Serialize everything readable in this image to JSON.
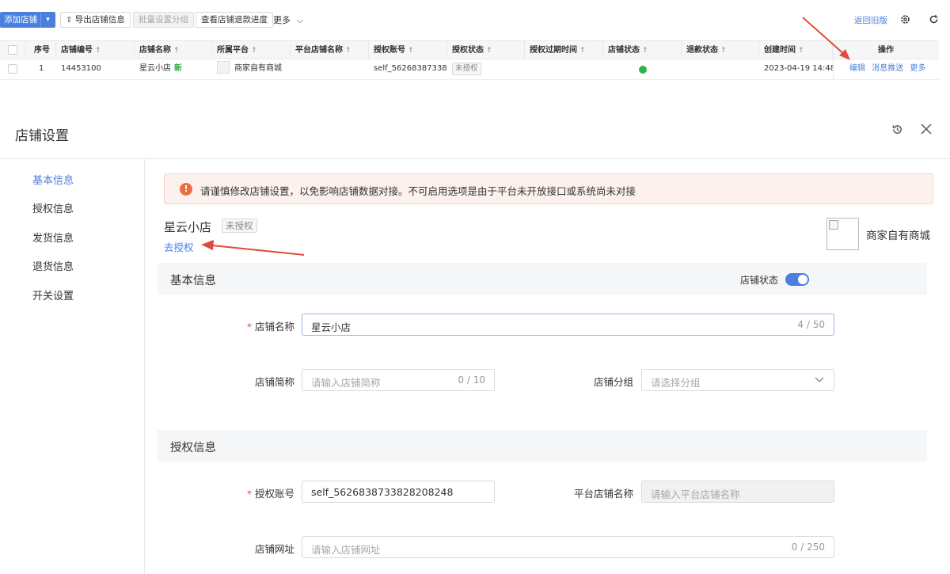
{
  "toolbar": {
    "add_store": "添加店铺",
    "export": "导出店铺信息",
    "batch_group": "批量设置分组",
    "refund_progress": "查看店铺退款进度",
    "more": "更多",
    "back_old": "返回旧版"
  },
  "table": {
    "headers": [
      "序号",
      "店铺编号",
      "店铺名称",
      "所属平台",
      "平台店铺名称",
      "授权账号",
      "授权状态",
      "授权过期时间",
      "店铺状态",
      "退款状态",
      "创建时间",
      "操作"
    ],
    "row": {
      "index": "1",
      "store_id": "14453100",
      "store_name": "星云小店",
      "new_tag": "新",
      "platform": "商家自有商城",
      "auth_account": "self_56268387338...",
      "auth_status": "未授权",
      "created": "2023-04-19 14:48:...",
      "actions": [
        "编辑",
        "消息推送",
        "更多"
      ]
    }
  },
  "panel": {
    "title": "店铺设置",
    "side_menu": [
      "基本信息",
      "授权信息",
      "发货信息",
      "退货信息",
      "开关设置"
    ],
    "alert": "请谨慎修改店铺设置，以免影响店铺数据对接。不可启用选项是由于平台未开放接口或系统尚未对接",
    "store_name": "星云小店",
    "auth_tag": "未授权",
    "go_auth": "去授权",
    "platform_name": "商家自有商城",
    "basic_section": "基本信息",
    "store_status_label": "店铺状态",
    "store_status_on": true,
    "fields": {
      "name_label": "店铺名称",
      "name_value": "星云小店",
      "name_count": "4 / 50",
      "short_label": "店铺简称",
      "short_placeholder": "请输入店铺简称",
      "short_count": "0 / 10",
      "group_label": "店铺分组",
      "group_placeholder": "请选择分组",
      "auth_section": "授权信息",
      "auth_label": "授权账号",
      "auth_value": "self_5626838733828208248",
      "plat_name_label": "平台店铺名称",
      "plat_name_placeholder": "请输入平台店铺名称",
      "url_label": "店铺网址",
      "url_placeholder": "请输入店铺网址",
      "url_count": "0 / 250"
    }
  },
  "colors": {
    "accent": "#4a7fe0",
    "annotation": "#e04a3a"
  }
}
